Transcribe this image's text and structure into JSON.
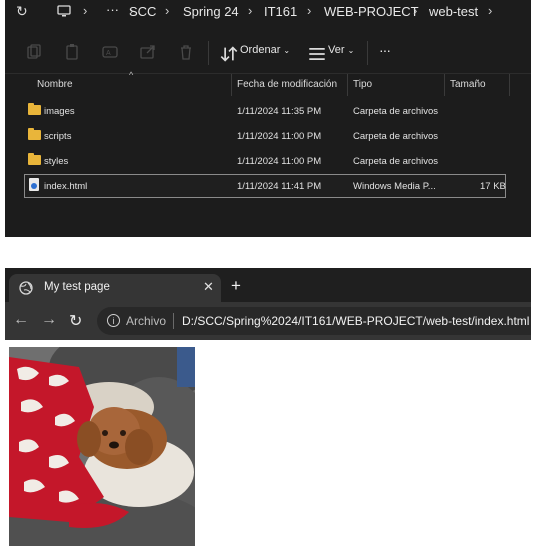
{
  "explorer": {
    "breadcrumbs": [
      "SCC",
      "Spring 24",
      "IT161",
      "WEB-PROJECT",
      "web-test"
    ],
    "breadcrumb_overflow": "···",
    "toolbar": {
      "sort_label": "Ordenar",
      "view_label": "Ver",
      "more_label": "···"
    },
    "columns": {
      "name": "Nombre",
      "modified": "Fecha de modificación",
      "type": "Tipo",
      "size": "Tamaño"
    },
    "files": [
      {
        "name": "images",
        "modified": "1/11/2024 11:35 PM",
        "type": "Carpeta de archivos",
        "size": "",
        "icon": "folder-icon"
      },
      {
        "name": "scripts",
        "modified": "1/11/2024 11:00 PM",
        "type": "Carpeta de archivos",
        "size": "",
        "icon": "folder-icon"
      },
      {
        "name": "styles",
        "modified": "1/11/2024 11:00 PM",
        "type": "Carpeta de archivos",
        "size": "",
        "icon": "folder-icon"
      },
      {
        "name": "index.html",
        "modified": "1/11/2024 11:41 PM",
        "type": "Windows Media P...",
        "size": "17 KB",
        "icon": "html-file-icon",
        "selected": true
      }
    ]
  },
  "browser": {
    "tab_title": "My test page",
    "tab_close": "✕",
    "new_tab": "+",
    "site_info_label": "Archivo",
    "url": "D:/SCC/Spring%2024/IT161/WEB-PROJECT/web-test/index.html"
  },
  "page": {
    "image_icon": "dog-photo"
  },
  "colors": {
    "explorer_bg": "#1c1c1c",
    "browser_tabbar": "#1f1f1f",
    "browser_toolbar": "#353535",
    "folder": "#e9b53a"
  }
}
